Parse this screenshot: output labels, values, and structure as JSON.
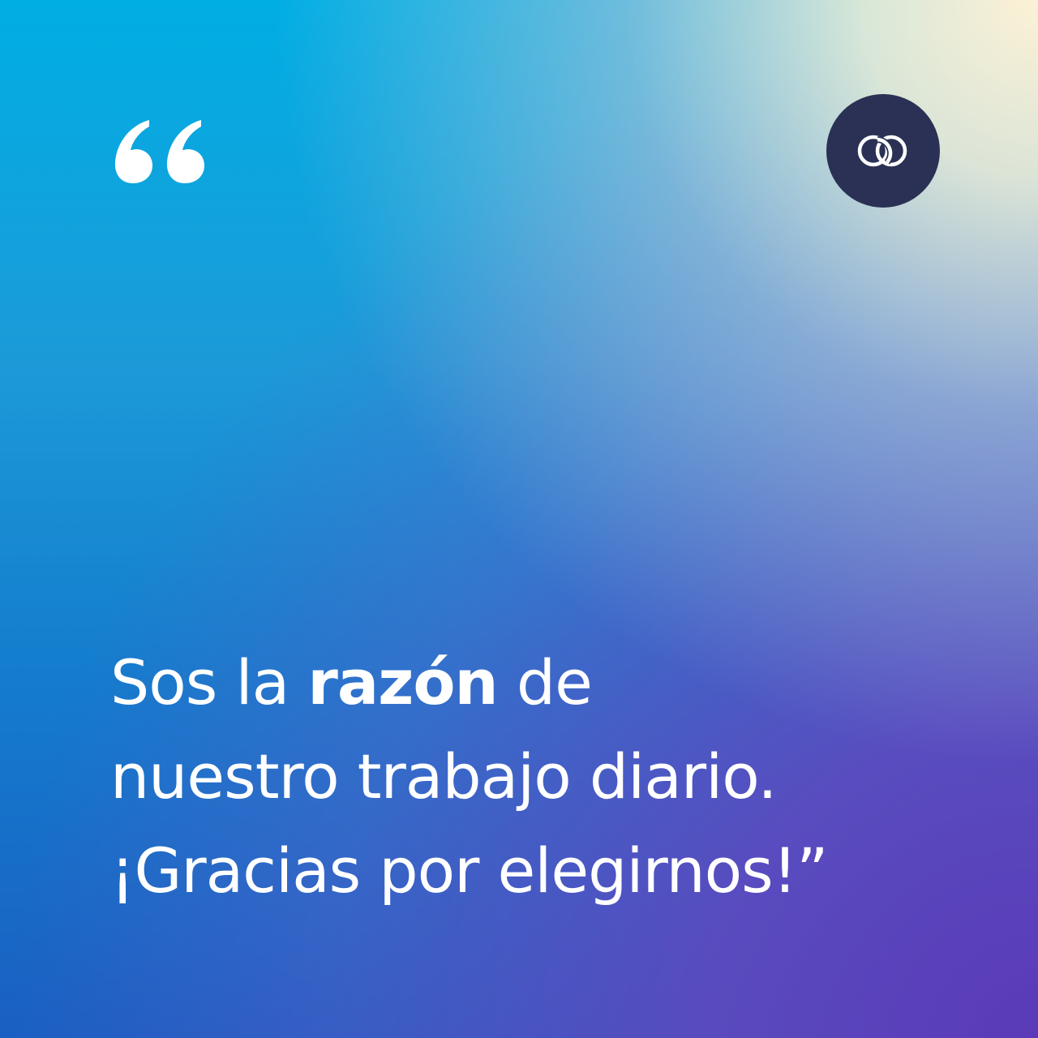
{
  "colors": {
    "text": "#ffffff",
    "badge_background": "#2b3154",
    "gradient_top_left": "#00aee4",
    "gradient_top_right": "#fdf1d6",
    "gradient_bottom_right": "#5a3ab8",
    "gradient_bottom_left": "#1a5fc2"
  },
  "icons": {
    "quote": "opening-quotation-mark-icon",
    "logo": "interlocking-rings-logo-icon"
  },
  "message": {
    "line1_pre": "Sos la ",
    "line1_bold": "razón",
    "line1_post": " de",
    "line2": "nuestro trabajo diario.",
    "line3": "¡Gracias por elegirnos!”"
  }
}
